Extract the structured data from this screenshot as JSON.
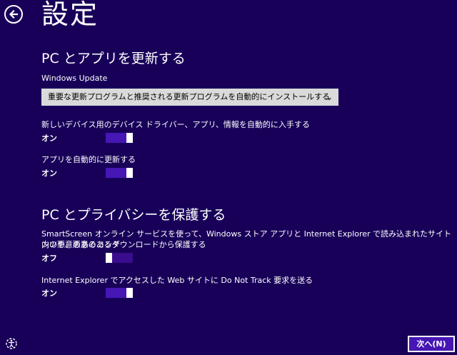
{
  "page": {
    "title": "設定"
  },
  "sections": {
    "update": {
      "heading": "PC とアプリを更新する",
      "windows_update_label": "Windows Update",
      "windows_update_selected": "重要な更新プログラムと推奨される更新プログラムを自動的にインストールする",
      "drivers_label": "新しいデバイス用のデバイス ドライバー、アプリ、情報を自動的に入手する",
      "drivers_state": "オン",
      "apps_label": "アプリを自動的に更新する",
      "apps_state": "オン"
    },
    "privacy": {
      "heading": "PC とプライバシーを保護する",
      "smartscreen_label_line1": "SmartScreen オンライン サービスを使って、Windows ストア アプリと Internet Explorer で読み込まれたサイト内の悪意のあるコンテ",
      "smartscreen_label_line2": "ンツや、悪意のあるダウンロードから保護する",
      "smartscreen_state": "オフ",
      "dnt_label": "Internet Explorer でアクセスした Web サイトに Do Not Track 要求を送る",
      "dnt_state": "オン"
    }
  },
  "toggles": {
    "drivers": true,
    "apps": true,
    "smartscreen": false,
    "dnt": true
  },
  "footer": {
    "next_label": "次へ(N)"
  },
  "icons": {
    "back": "back-arrow-icon",
    "ease_of_access": "ease-of-access-icon",
    "dropdown": "chevron-down-icon"
  },
  "colors": {
    "background": "#180059",
    "accent": "#4617b4",
    "dropdown_bg": "#dadada"
  }
}
